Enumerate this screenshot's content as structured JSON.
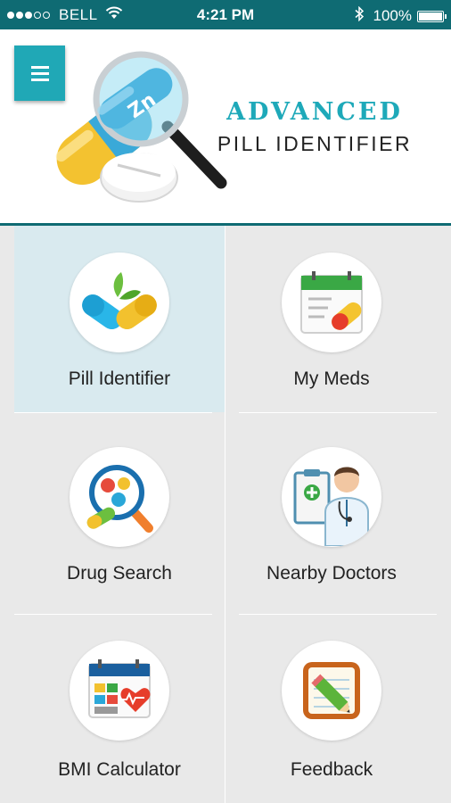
{
  "status_bar": {
    "carrier": "BELL",
    "time": "4:21 PM",
    "battery": "100%",
    "icons": [
      "signal-dots-icon",
      "wifi-icon",
      "bluetooth-icon",
      "battery-icon"
    ]
  },
  "header": {
    "title_line1": "ADVANCED",
    "title_line2": "PILL IDENTIFIER",
    "logo_badge": "Zn"
  },
  "menu": {
    "items": [
      {
        "label": "Pill Identifier",
        "icon": "capsule-leaf-icon"
      },
      {
        "label": "My Meds",
        "icon": "calendar-pill-icon"
      },
      {
        "label": "Drug Search",
        "icon": "magnifier-pills-icon"
      },
      {
        "label": "Nearby Doctors",
        "icon": "doctor-icon"
      },
      {
        "label": "BMI Calculator",
        "icon": "calculator-heart-icon"
      },
      {
        "label": "Feedback",
        "icon": "notepad-pencil-icon"
      }
    ]
  },
  "colors": {
    "status_bar": "#0f6b73",
    "accent": "#20a8b6",
    "selected_tile": "#d9eaef",
    "background": "#e9e9e9"
  }
}
